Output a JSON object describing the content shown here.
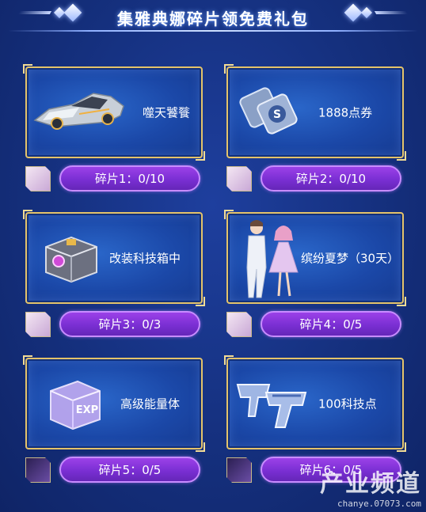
{
  "header": {
    "title": "集雅典娜碎片领免费礼包"
  },
  "rewards": [
    {
      "label": "噬天饕餮",
      "fragment": "碎片1：0/10",
      "icon": "race-car-icon"
    },
    {
      "label": "1888点券",
      "fragment": "碎片2：0/10",
      "icon": "coupon-cards-icon"
    },
    {
      "label": "改装科技箱中",
      "fragment": "碎片3：0/3",
      "icon": "tech-box-icon"
    },
    {
      "label": "缤纷夏梦（30天）",
      "fragment": "碎片4：0/5",
      "icon": "couple-outfit-icon"
    },
    {
      "label": "高级能量体",
      "fragment": "碎片5：0/5",
      "icon": "exp-crystal-icon"
    },
    {
      "label": "100科技点",
      "fragment": "碎片6：0/5",
      "icon": "tech-point-icon"
    }
  ],
  "watermark": {
    "main": "产业频道",
    "sub": "chanye.07073.com"
  }
}
